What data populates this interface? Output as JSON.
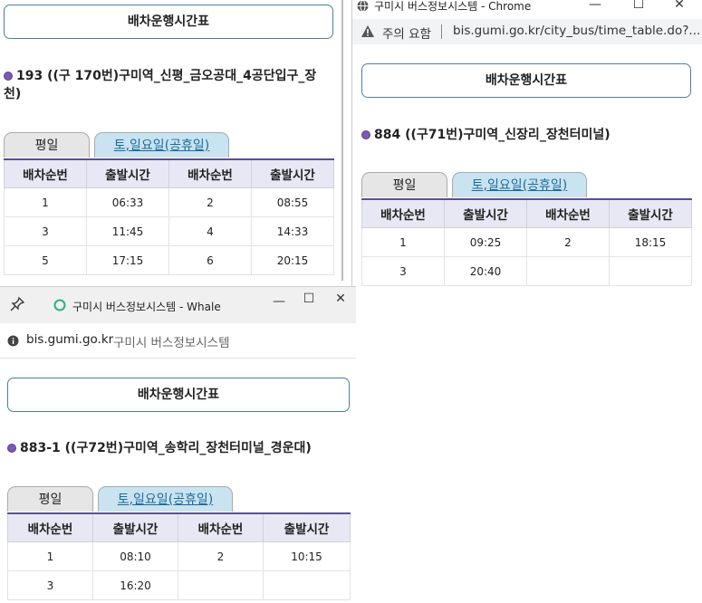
{
  "left_window": {
    "page_title_box": "배차운행시간표",
    "route": "193 ((구 170번)구미역_신평_금오공대_4공단입구_장천)",
    "tabs": {
      "weekday": "평일",
      "weekend": "토,일요일(공휴일)"
    },
    "headers": [
      "배차순번",
      "출발시간",
      "배차순번",
      "출발시간"
    ],
    "rows": [
      [
        "1",
        "06:33",
        "2",
        "08:55"
      ],
      [
        "3",
        "11:45",
        "4",
        "14:33"
      ],
      [
        "5",
        "17:15",
        "6",
        "20:15"
      ]
    ]
  },
  "chrome_window": {
    "title": "구미시 버스정보시스템 - Chrome",
    "warning": "주의 요함",
    "url": "bis.gumi.go.kr/city_bus/time_table.do?...",
    "page_title_box": "배차운행시간표",
    "route": "884 ((구71번)구미역_신장리_장천터미널)",
    "tabs": {
      "weekday": "평일",
      "weekend": "토,일요일(공휴일)"
    },
    "headers": [
      "배차순번",
      "출발시간",
      "배차순번",
      "출발시간"
    ],
    "rows": [
      [
        "1",
        "09:25",
        "2",
        "18:15"
      ],
      [
        "3",
        "20:40",
        "",
        ""
      ]
    ]
  },
  "whale_window": {
    "title": "구미시 버스정보시스템 - Whale",
    "url": "bis.gumi.go.kr",
    "site_name": "구미시 버스정보시스템",
    "page_title_box": "배차운행시간표",
    "route": "883-1 ((구72번)구미역_송학리_장천터미널_경운대)",
    "tabs": {
      "weekday": "평일",
      "weekend": "토,일요일(공휴일)"
    },
    "headers": [
      "배차순번",
      "출발시간",
      "배차순번",
      "출발시간"
    ],
    "rows": [
      [
        "1",
        "08:10",
        "2",
        "10:15"
      ],
      [
        "3",
        "16:20",
        "",
        ""
      ]
    ]
  },
  "window_controls": {
    "minimize": "—",
    "maximize": "☐",
    "close": "✕"
  },
  "icons": {
    "chrome": "globe-icon",
    "whale": "whale-logo-icon",
    "pin": "pin-icon",
    "warning": "warning-icon",
    "info": "info-icon"
  }
}
